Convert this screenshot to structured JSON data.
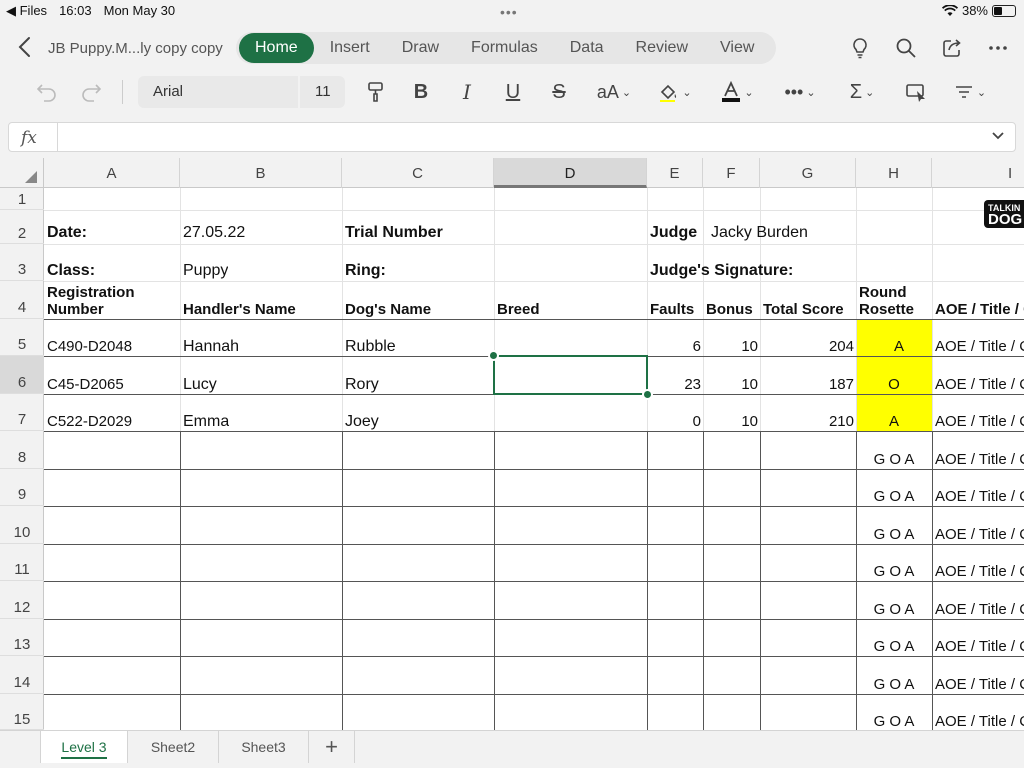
{
  "status_bar": {
    "back_app": "Files",
    "time": "16:03",
    "date": "Mon May 30",
    "battery": "38%"
  },
  "document": {
    "title": "JB Puppy.M...ly  copy copy"
  },
  "ribbon_tabs": [
    {
      "label": "Home",
      "active": true
    },
    {
      "label": "Insert"
    },
    {
      "label": "Draw"
    },
    {
      "label": "Formulas"
    },
    {
      "label": "Data"
    },
    {
      "label": "Review"
    },
    {
      "label": "View"
    }
  ],
  "toolbar": {
    "font_name": "Arial",
    "font_size": "11",
    "text_size_label": "aA"
  },
  "formula_bar": {
    "label": "fx",
    "value": ""
  },
  "columns": [
    "A",
    "B",
    "C",
    "D",
    "E",
    "F",
    "G",
    "H",
    "I"
  ],
  "selected_column": "D",
  "selected_row": "6",
  "rows": [
    "1",
    "2",
    "3",
    "4",
    "5",
    "6",
    "7",
    "8",
    "9",
    "10",
    "11",
    "12",
    "13",
    "14",
    "15"
  ],
  "sheet": {
    "date_label": "Date:",
    "date_value": "27.05.22",
    "trial_label": "Trial Number",
    "judge_label": "Judge",
    "judge_value": "Jacky Burden",
    "class_label": "Class:",
    "class_value": "Puppy",
    "ring_label": "Ring:",
    "signature_label": "Judge's Signature:",
    "logo_line1": "TALKIN",
    "logo_line2": "DOG",
    "headers": {
      "registration_line1": "Registration",
      "registration_line2": "Number",
      "handler": "Handler's Name",
      "dog": "Dog's Name",
      "breed": "Breed",
      "faults": "Faults",
      "bonus": "Bonus",
      "total": "Total Score",
      "rosette_line1": "Round",
      "rosette_line2": "Rosette",
      "aoe": "AOE / Title / C"
    },
    "entries": [
      {
        "reg": "C490-D2048",
        "handler": "Hannah",
        "dog": "Rubble",
        "faults": "6",
        "bonus": "10",
        "total": "204",
        "rosette": "A",
        "aoe": "AOE / Title / C"
      },
      {
        "reg": "C45-D2065",
        "handler": "Lucy",
        "dog": "Rory",
        "faults": "23",
        "bonus": "10",
        "total": "187",
        "rosette": "O",
        "aoe": "AOE / Title / C"
      },
      {
        "reg": "C522-D2029",
        "handler": "Emma",
        "dog": "Joey",
        "faults": "0",
        "bonus": "10",
        "total": "210",
        "rosette": "A",
        "aoe": "AOE / Title / C"
      }
    ],
    "empty_rosette": "G   O   A",
    "empty_aoe": "AOE / Title / C"
  },
  "sheet_tabs": [
    {
      "label": "Level 3",
      "active": true
    },
    {
      "label": "Sheet2"
    },
    {
      "label": "Sheet3"
    }
  ],
  "add_sheet_label": "+",
  "colors": {
    "accent": "#1e7145",
    "highlight": "#ffff00"
  }
}
